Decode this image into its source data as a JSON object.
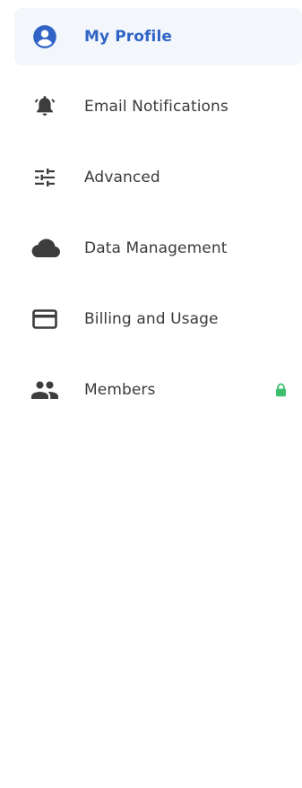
{
  "colors": {
    "accent": "#2f64c6",
    "active_bg": "#f3f7fc",
    "icon": "#3d3d3d",
    "text": "#3a3a3a",
    "lock": "#3fbf6d"
  },
  "sidebar": {
    "items": [
      {
        "label": "My Profile",
        "icon": "account-circle-icon",
        "active": true
      },
      {
        "label": "Email Notifications",
        "icon": "bell-ringing-icon",
        "active": false
      },
      {
        "label": "Advanced",
        "icon": "tune-sliders-icon",
        "active": false
      },
      {
        "label": "Data Management",
        "icon": "cloud-icon",
        "active": false
      },
      {
        "label": "Billing and Usage",
        "icon": "credit-card-icon",
        "active": false
      },
      {
        "label": "Members",
        "icon": "people-icon",
        "active": false,
        "locked": true,
        "lock_icon": "lock-icon"
      }
    ]
  }
}
